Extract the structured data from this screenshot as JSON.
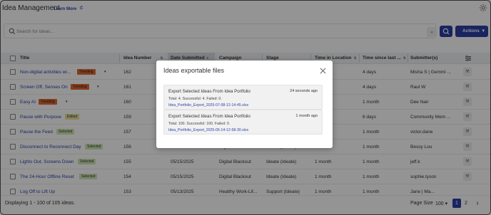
{
  "header": {
    "title": "Idea Management",
    "learn_more": "Learn More"
  },
  "search": {
    "placeholder": "Search for ideas...",
    "actions_label": "Actions",
    "actions_caret": "▾",
    "dropdown_glyph": "⌄"
  },
  "table": {
    "columns": [
      "Title",
      "Idea Number",
      "Date Submitted",
      "Campaign",
      "Stage",
      "Time in Location",
      "Time since last ...",
      "Submitter(s)"
    ],
    "sort_glyph": "⇅",
    "rows": [
      {
        "title": "Non-digital activities wi...",
        "badge": "Trending",
        "badge_type": "trending",
        "caret": "▾",
        "idea_number": "162",
        "date": "",
        "campaign": "",
        "stage": "",
        "time_in_location": "",
        "time_since": "4 days",
        "submitter": "Misha S | Gemmi ..."
      },
      {
        "title": "Screen Off, Senses On",
        "badge": "Trending",
        "badge_type": "trending",
        "caret": "▾",
        "idea_number": "161",
        "date": "",
        "campaign": "",
        "stage": "",
        "time_in_location": "",
        "time_since": "4 days",
        "submitter": "Raul W"
      },
      {
        "title": "Easy AI",
        "badge": "Trending",
        "badge_type": "trending",
        "caret": "▾",
        "idea_number": "160",
        "date": "",
        "campaign": "",
        "stage": "",
        "time_in_location": "",
        "time_since": "1 month",
        "submitter": "Dee Nair"
      },
      {
        "title": "Pause with Purpose",
        "badge": "Edited",
        "badge_type": "edited",
        "caret": "",
        "idea_number": "159",
        "date": "",
        "campaign": "",
        "stage": "",
        "time_in_location": "",
        "time_since": "6 days",
        "submitter": "Community Mem ..."
      },
      {
        "title": "Pause the Feed",
        "badge": "Selected",
        "badge_type": "selected",
        "caret": "",
        "idea_number": "157",
        "date": "",
        "campaign": "",
        "stage": "",
        "time_in_location": "",
        "time_since": "1 month",
        "submitter": "victor.dane"
      },
      {
        "title": "Disconnect to Reconnect Day",
        "badge": "Selected",
        "badge_type": "selected",
        "caret": "",
        "idea_number": "156",
        "date": "05/15/2025",
        "campaign": "Digital Blackout",
        "stage": "Ideate (Ideate)",
        "time_in_location": "1 month",
        "time_since": "1 month",
        "submitter": "Bessy Lou"
      },
      {
        "title": "Lights Out, Screens Down",
        "badge": "Selected",
        "badge_type": "selected",
        "caret": "",
        "idea_number": "155",
        "date": "05/15/2025",
        "campaign": "Digital Blackout",
        "stage": "Ideate (Ideate)",
        "time_in_location": "1 month",
        "time_since": "1 month",
        "submitter": "jeff.k"
      },
      {
        "title": "The 24-Hour Offline Reset",
        "badge": "Selected",
        "badge_type": "selected",
        "caret": "",
        "idea_number": "154",
        "date": "05/15/2025",
        "campaign": "Digital Blackout",
        "stage": "Ideate (Ideate)",
        "time_in_location": "1 month",
        "time_since": "1 month",
        "submitter": "sophie.tyson"
      },
      {
        "title": "Log Off to Lift Up",
        "badge": "",
        "badge_type": "",
        "caret": "",
        "idea_number": "153",
        "date": "05/13/2025",
        "campaign": "Healthy Work-Lif...",
        "stage": "Support (Ideate)",
        "time_in_location": "1 month",
        "time_since": "1 month",
        "submitter": "Jane | Ma..."
      }
    ]
  },
  "footer": {
    "info": "Displaying 1 - 100 of 105 ideas.",
    "page_size_label": "Page Size",
    "page_size_value": "100",
    "page_size_caret": "▾",
    "pages": [
      "1",
      "2"
    ],
    "next_glyph": "›"
  },
  "modal": {
    "title": "Ideas exportable files",
    "exports": [
      {
        "title": "Export Selected Ideas From Idea Portfolio",
        "time": "24 seconds ago",
        "stats": "Total: 4. Successful: 4. Failed: 0.",
        "file": "Idea_Portfolio_Export_2025-07-08-12-14-45.xlsx"
      },
      {
        "title": "Export Selected Ideas From Idea Portfolio",
        "time": "1 month ago",
        "stats": "Total: 100. Successful: 100. Failed: 0.",
        "file": "Idea_Portfolio_Export_2025-05-14-12-58-30.xlsx"
      }
    ]
  },
  "colors": {
    "accent": "#2b3fa8",
    "trending": "#e06a35",
    "edited": "#e7e29b",
    "selected": "#cfe8b3"
  }
}
